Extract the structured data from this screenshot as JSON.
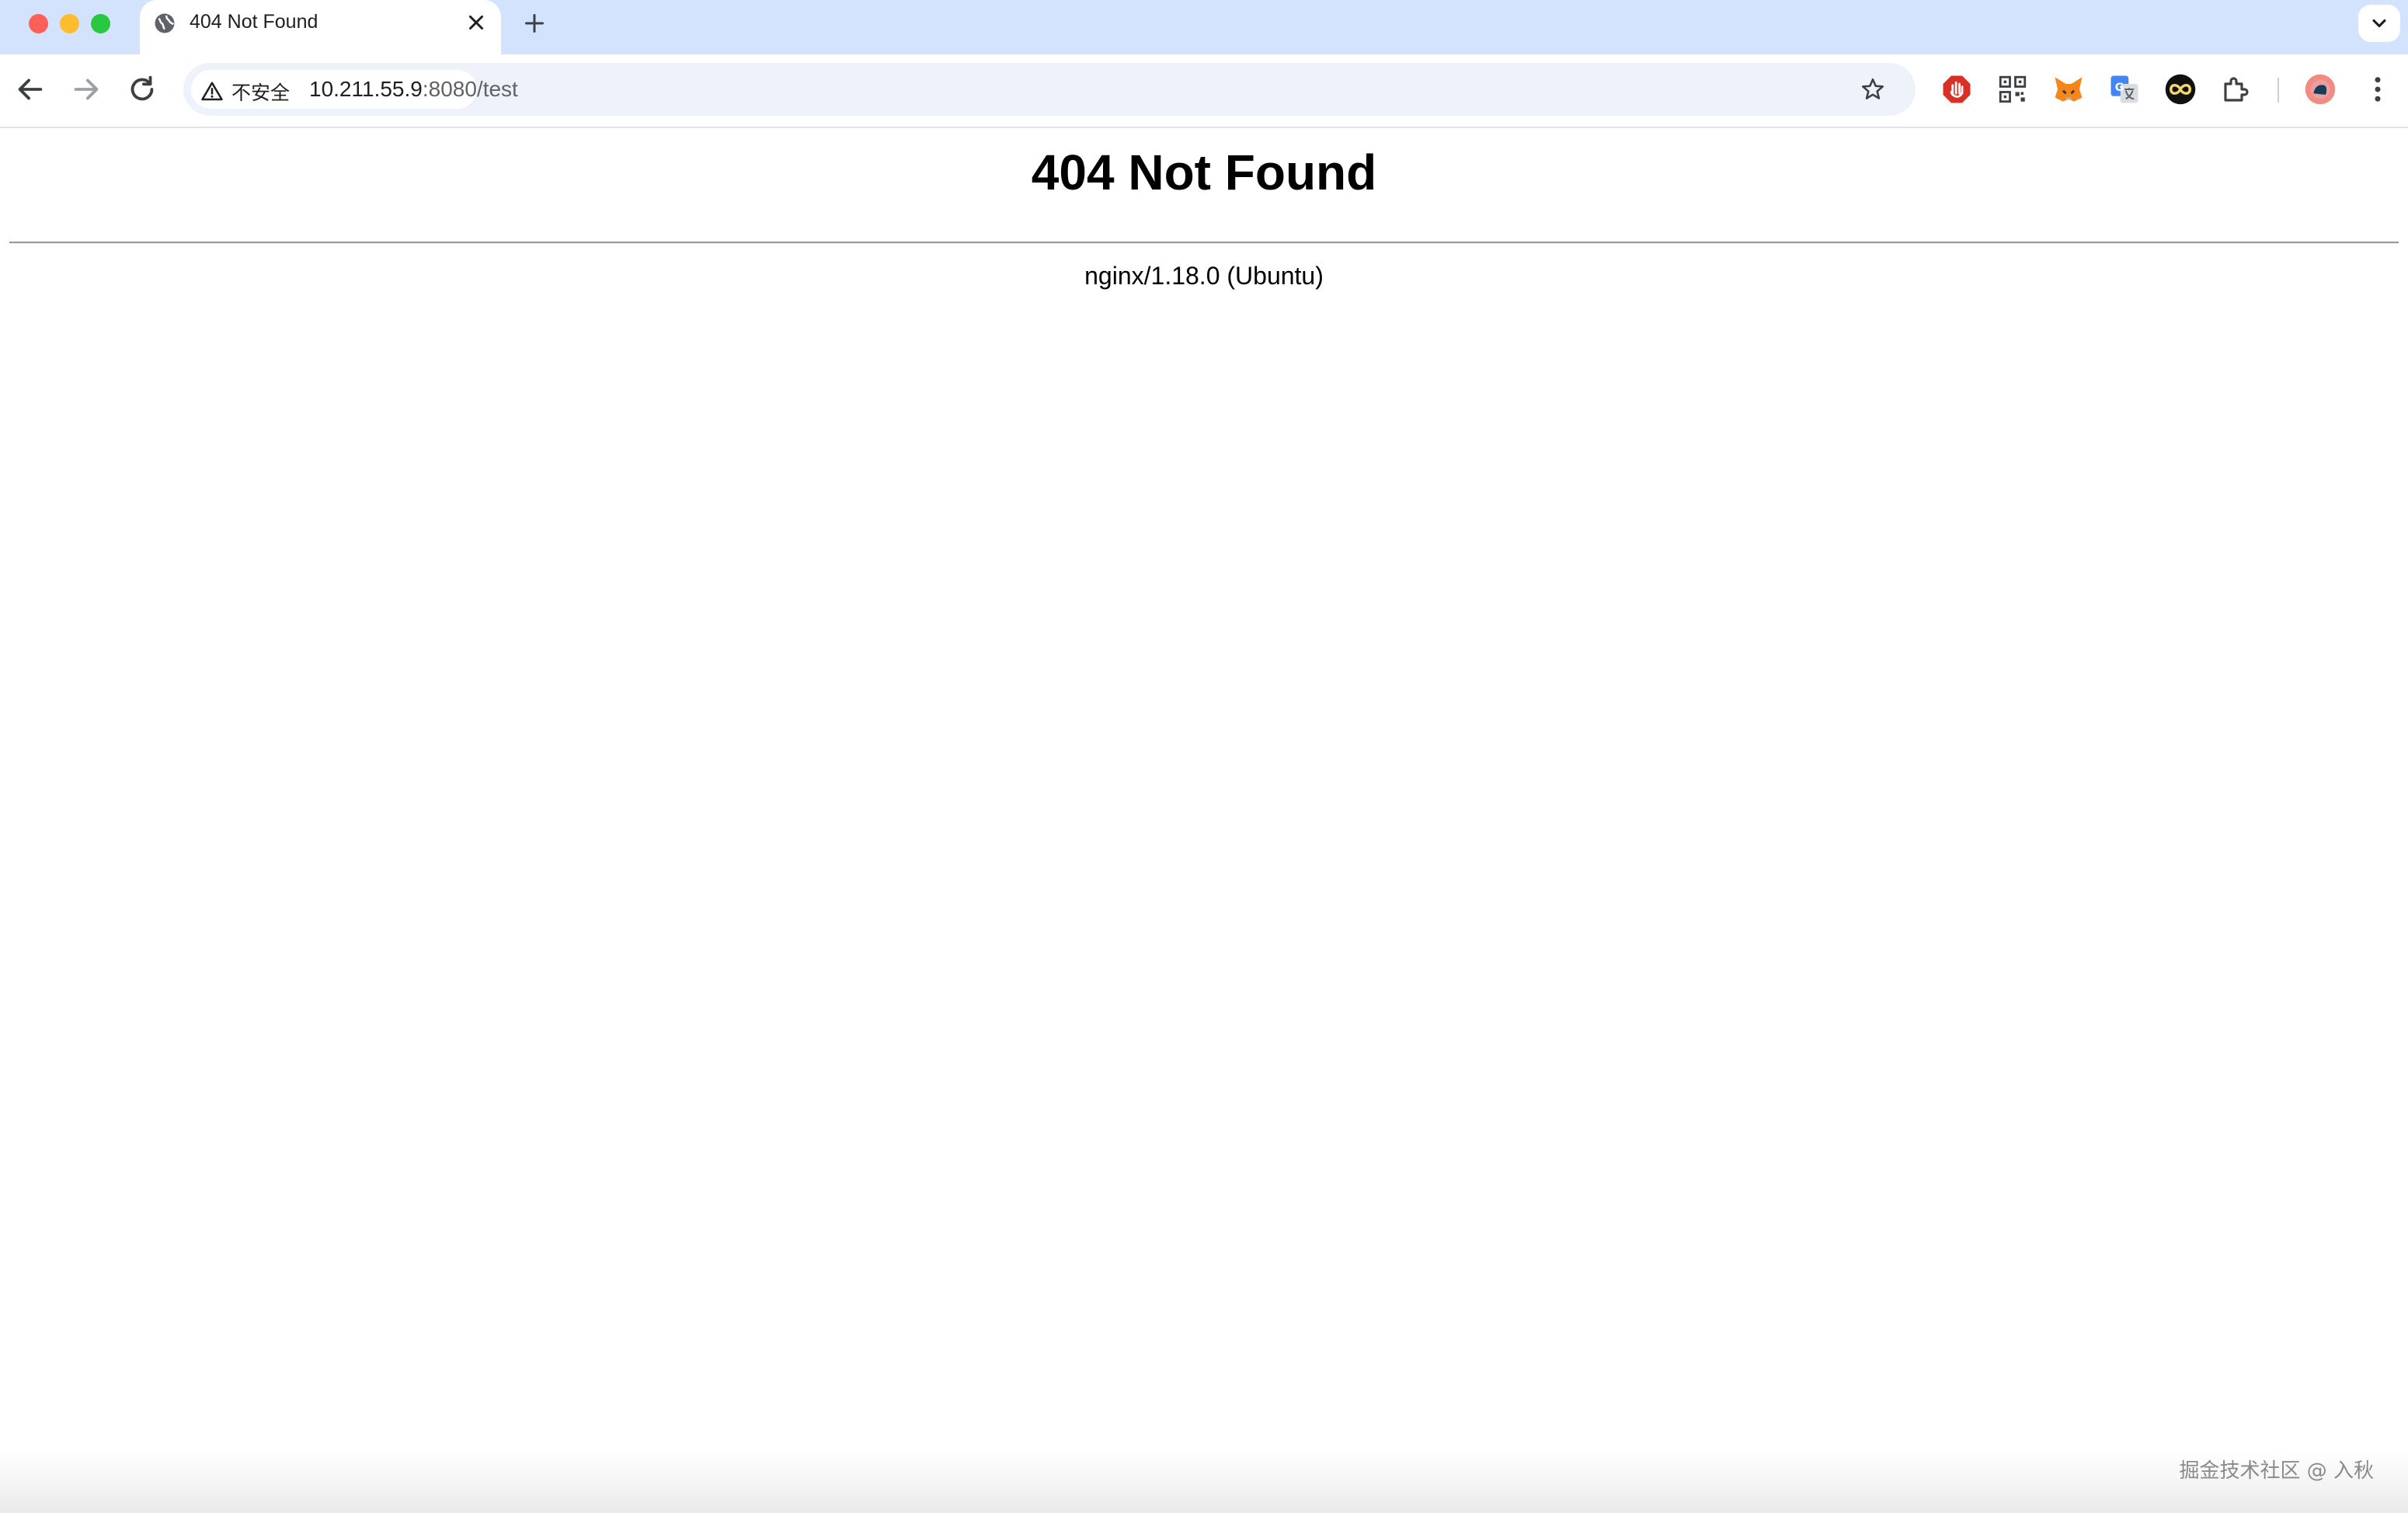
{
  "browser": {
    "tab": {
      "title": "404 Not Found",
      "favicon": "globe-icon"
    },
    "address": {
      "security_label": "不安全",
      "security_icon": "warning-triangle-icon",
      "host": "10.211.55.9",
      "path": ":8080/test"
    },
    "extensions": [
      "stop-hand-extension-icon",
      "qr-code-extension-icon",
      "metamask-fox-icon",
      "google-translate-icon",
      "infinity-extension-icon",
      "puzzle-extensions-icon"
    ],
    "colors": {
      "tabstrip": "#d3e3fd",
      "omnibox": "#eef2fa"
    }
  },
  "page": {
    "heading": "404 Not Found",
    "server": "nginx/1.18.0 (Ubuntu)"
  },
  "watermark": "掘金技术社区 @ 入秋"
}
